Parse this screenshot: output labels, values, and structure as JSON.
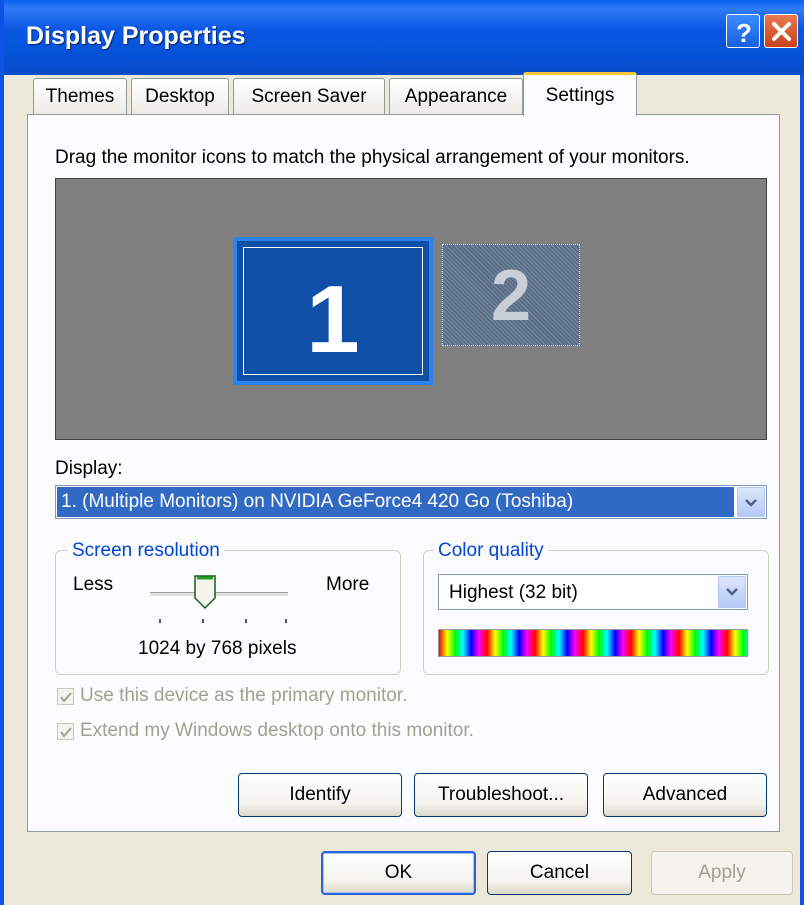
{
  "window": {
    "title": "Display Properties"
  },
  "titlebar_buttons": {
    "help_icon": "help-icon",
    "close_icon": "close-icon"
  },
  "tabs": [
    {
      "label": "Themes",
      "active": false
    },
    {
      "label": "Desktop",
      "active": false
    },
    {
      "label": "Screen Saver",
      "active": false
    },
    {
      "label": "Appearance",
      "active": false
    },
    {
      "label": "Settings",
      "active": true
    }
  ],
  "settings": {
    "instruction": "Drag the monitor icons to match the physical arrangement of your monitors.",
    "monitors": [
      {
        "number": "1",
        "selected": true
      },
      {
        "number": "2",
        "selected": false
      }
    ],
    "display_label": "Display:",
    "display_value": "1. (Multiple Monitors) on NVIDIA GeForce4 420 Go (Toshiba)",
    "resolution": {
      "title": "Screen resolution",
      "less_label": "Less",
      "more_label": "More",
      "value_text": "1024 by 768 pixels",
      "slider_level": 0.4
    },
    "color_quality": {
      "title": "Color quality",
      "value": "Highest (32 bit)"
    },
    "checkboxes": [
      {
        "label": "Use this device as the primary monitor.",
        "checked": true,
        "enabled": false
      },
      {
        "label": "Extend my Windows desktop onto this monitor.",
        "checked": true,
        "enabled": false
      }
    ],
    "buttons": {
      "identify": "Identify",
      "troubleshoot": "Troubleshoot...",
      "advanced": "Advanced"
    }
  },
  "dialog_buttons": {
    "ok": "OK",
    "cancel": "Cancel",
    "apply": "Apply"
  },
  "colors": {
    "titlebar": "#0553D9",
    "selection": "#316AC5",
    "group_title": "#0046D5",
    "active_tab_accent": "#FFC83C"
  }
}
